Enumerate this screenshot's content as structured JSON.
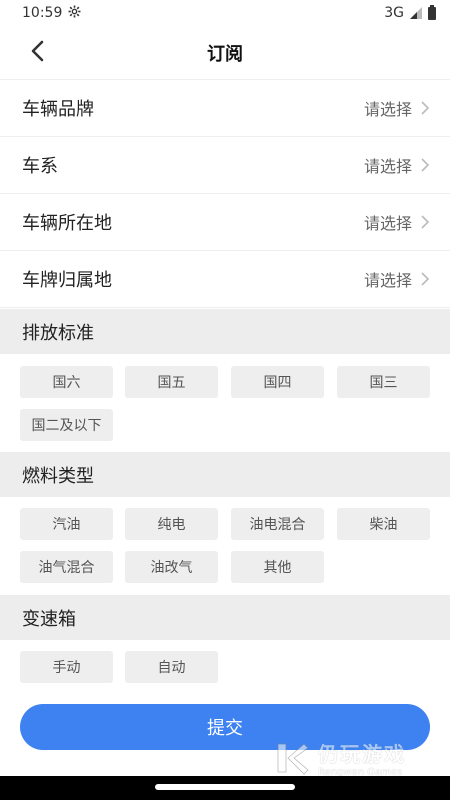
{
  "status_bar": {
    "time": "10:59",
    "network": "3G",
    "settings_icon": "gear-icon",
    "signal_icon": "signal-icon",
    "battery_icon": "battery-icon"
  },
  "header": {
    "title": "订阅",
    "back_icon": "chevron-left-icon"
  },
  "filters": [
    {
      "label": "车辆品牌",
      "value": "请选择"
    },
    {
      "label": "车系",
      "value": "请选择"
    },
    {
      "label": "车辆所在地",
      "value": "请选择"
    },
    {
      "label": "车牌归属地",
      "value": "请选择"
    }
  ],
  "emission": {
    "title": "排放标准",
    "options": [
      "国六",
      "国五",
      "国四",
      "国三",
      "国二及以下"
    ]
  },
  "fuel": {
    "title": "燃料类型",
    "options": [
      "汽油",
      "纯电",
      "油电混合",
      "柴油",
      "油气混合",
      "油改气",
      "其他"
    ]
  },
  "gearbox": {
    "title": "变速箱",
    "options": [
      "手动",
      "自动"
    ]
  },
  "submit_label": "提交",
  "watermark": {
    "cn": "仍玩游戏",
    "en": "Rengwan Games"
  },
  "colors": {
    "accent": "#3d82f0",
    "section_bg": "#ededed",
    "tag_bg": "#eeeeee"
  }
}
